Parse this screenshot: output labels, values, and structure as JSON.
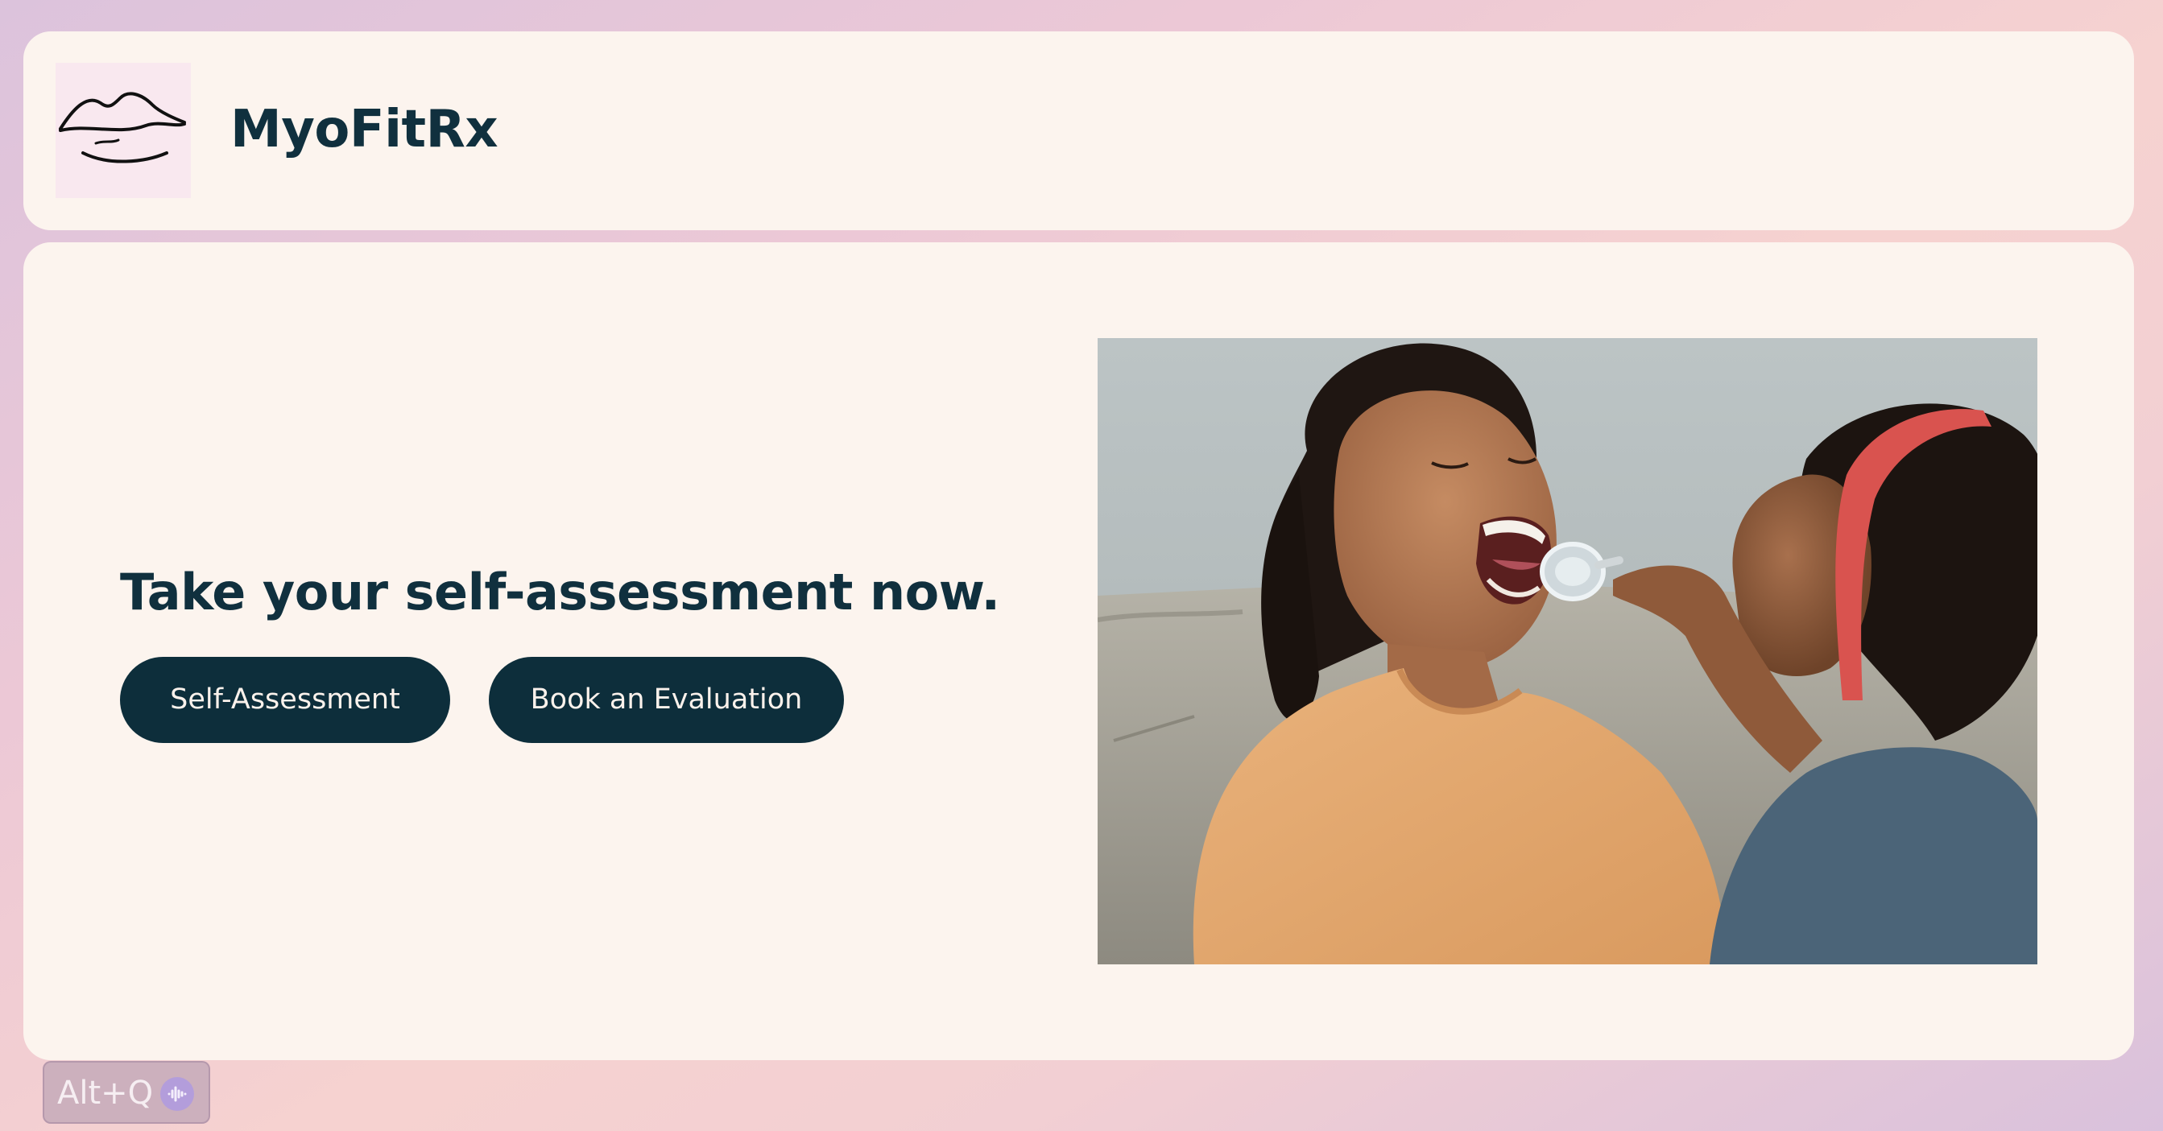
{
  "header": {
    "brand_name": "MyoFitRx",
    "logo_icon": "lips-icon"
  },
  "hero": {
    "headline": "Take your self-assessment now.",
    "buttons": {
      "self_assessment": "Self-Assessment",
      "book_evaluation": "Book an Evaluation"
    },
    "photo_icon": "photo-mother-daughter-mouth-mirror"
  },
  "shortcut_badge": {
    "label": "Alt+Q",
    "icon": "voice-wave-icon"
  },
  "colors": {
    "card_background": "#fcf4ee",
    "primary_dark": "#0d2e3b",
    "text_dark": "#10303e",
    "logo_background": "#f9e8ef",
    "badge_icon": "#b39ddb"
  }
}
